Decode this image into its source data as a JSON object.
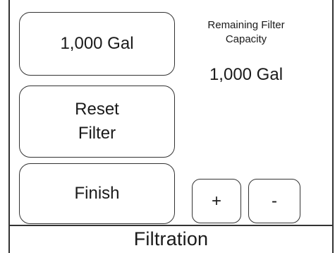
{
  "screen": {
    "title": "Filtration"
  },
  "buttons": {
    "volume_label": "1,000 Gal",
    "reset_label": "Reset\nFilter",
    "finish_label": "Finish",
    "plus_label": "+",
    "minus_label": "-"
  },
  "capacity": {
    "label": "Remaining Filter\nCapacity",
    "value": "1,000 Gal"
  }
}
